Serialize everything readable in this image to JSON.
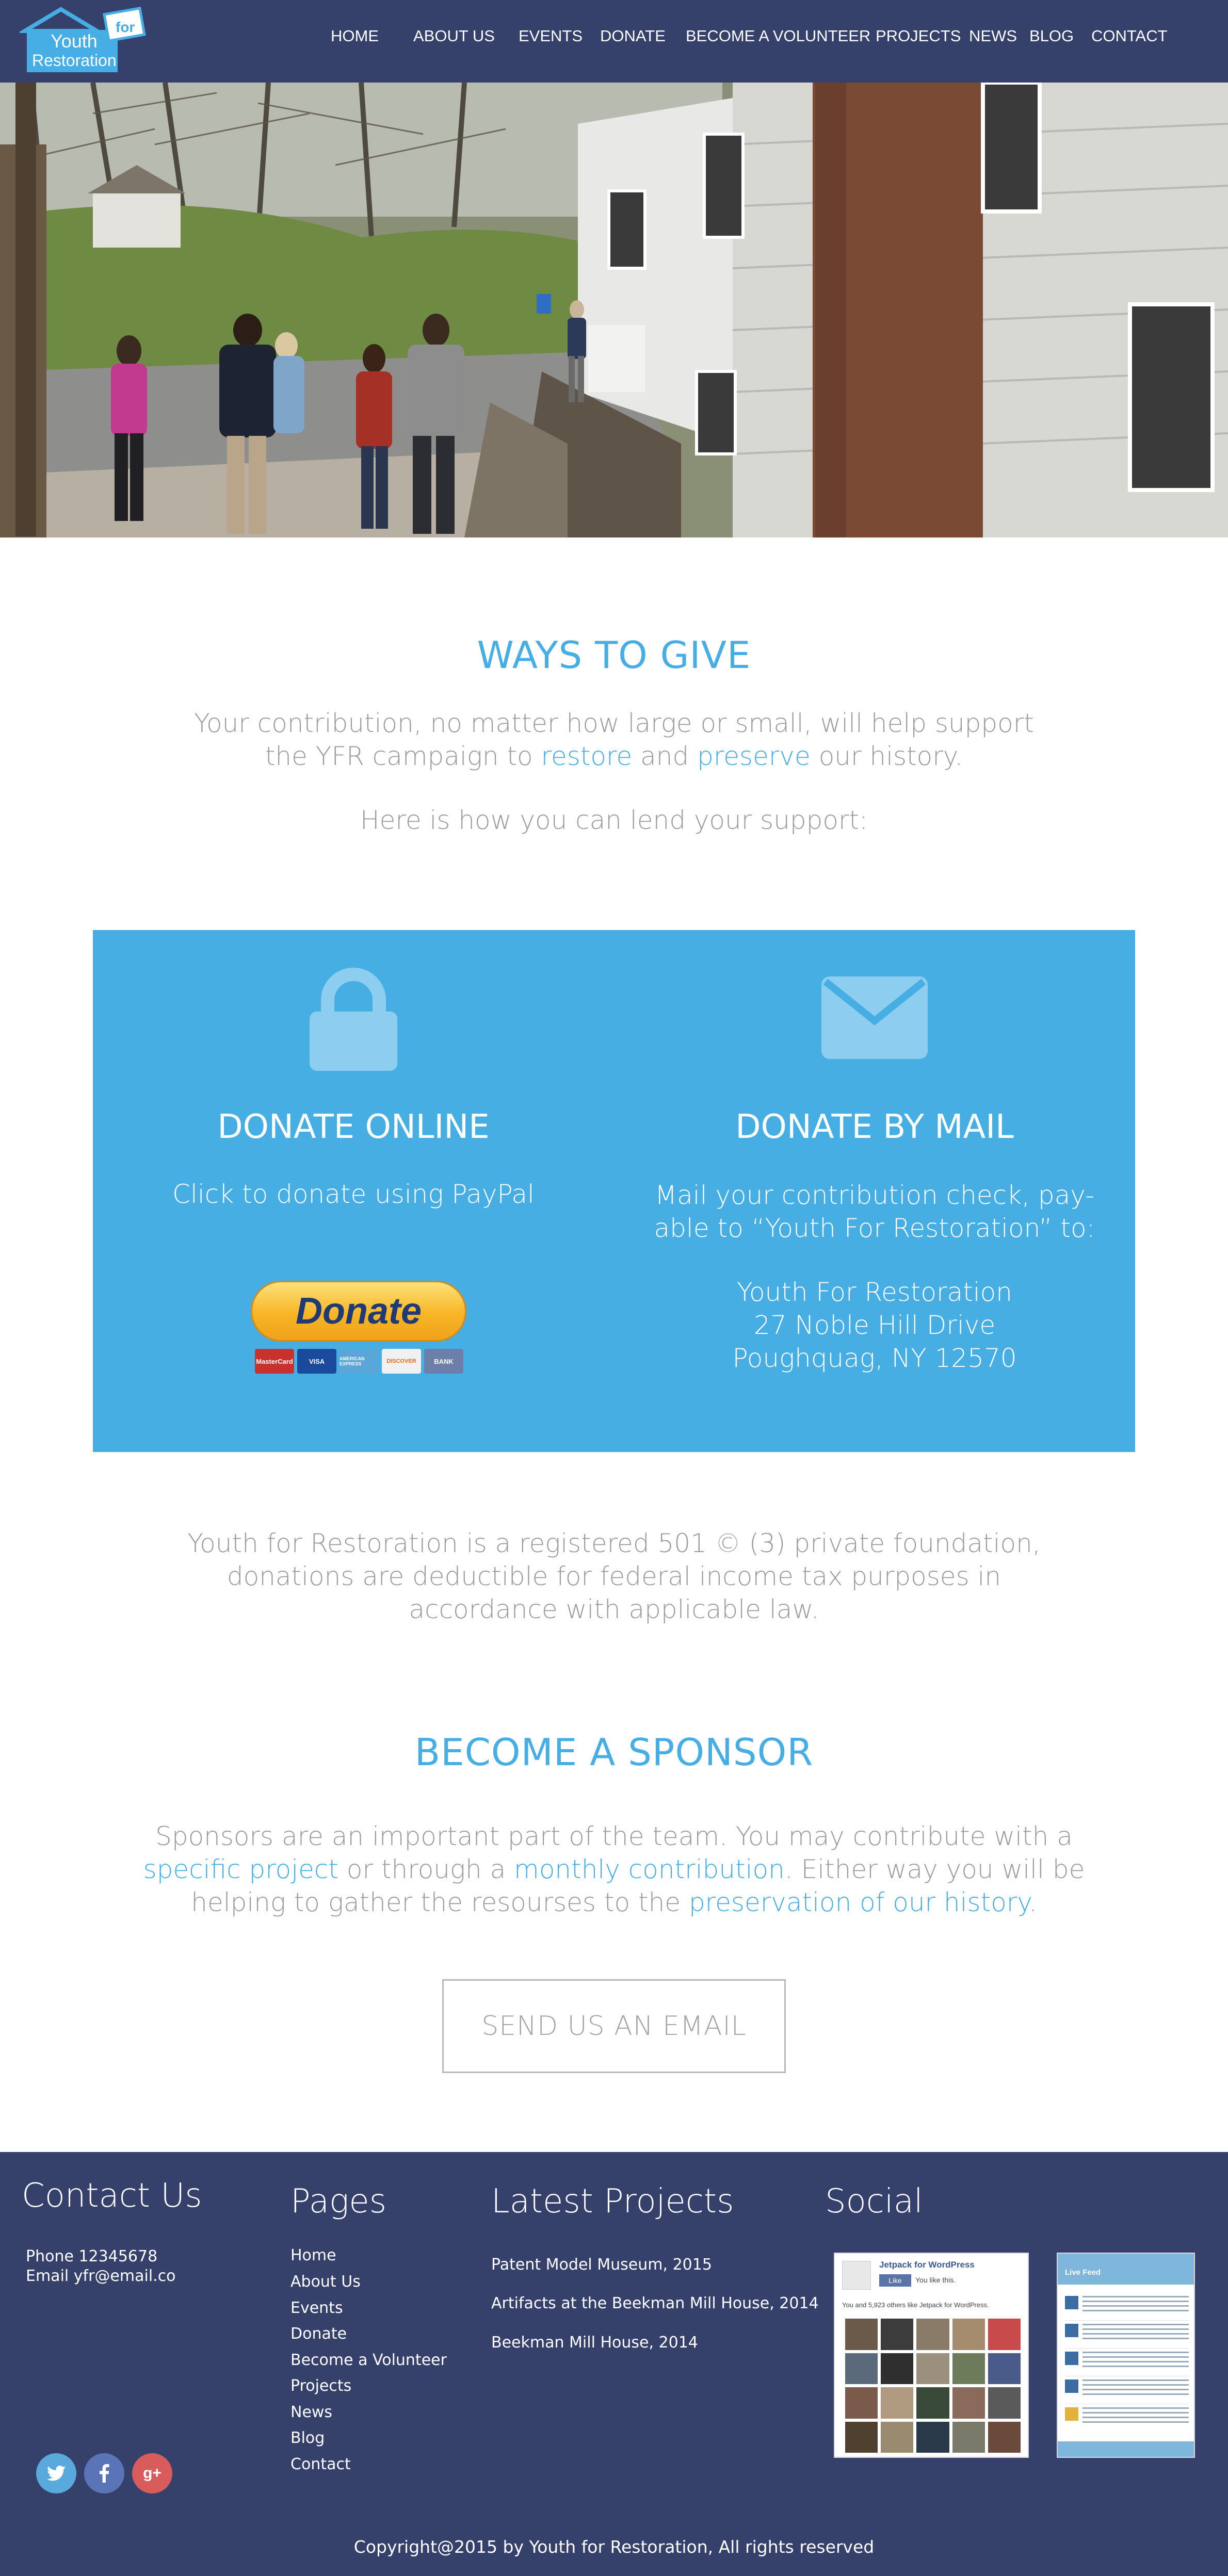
{
  "brand": {
    "logo_line1": "Youth",
    "logo_line2": "Restoration",
    "logo_badge": "for"
  },
  "nav": {
    "items": [
      {
        "label": "HOME"
      },
      {
        "label": "ABOUT US"
      },
      {
        "label": "EVENTS"
      },
      {
        "label": "DONATE"
      },
      {
        "label": "BECOME A VOLUNTEER"
      },
      {
        "label": "PROJECTS"
      },
      {
        "label": "NEWS"
      },
      {
        "label": "BLOG"
      },
      {
        "label": "CONTACT"
      }
    ]
  },
  "ways": {
    "title": "WAYS TO GIVE",
    "intro_part1": "Your contribution, no matter how large or small, will help support",
    "intro_part2": "the YFR campaign to",
    "intro_restore": "restore",
    "intro_and": "and",
    "intro_preserve": "preserve",
    "intro_part3": "our history.",
    "support_line": "Here is how you can lend your support:"
  },
  "online": {
    "title": "DONATE ONLINE",
    "text": "Click to donate using PayPal",
    "button_label": "Donate",
    "cards": [
      "MasterCard",
      "VISA",
      "AMERICAN EXPRESS",
      "DISCOVER",
      "BANK"
    ]
  },
  "mail": {
    "title": "DONATE BY MAIL",
    "text_line1": "Mail your contribution check, pay-",
    "text_line2": "able to “Youth For Restoration” to:",
    "address_line1": "Youth For Restoration",
    "address_line2": "27 Noble Hill Drive",
    "address_line3": "Poughquag, NY 12570"
  },
  "legal": {
    "line1": "Youth for Restoration is a registered 501 © (3) private foundation,",
    "line2": "donations are deductible for federal income tax purposes in",
    "line3": "accordance with applicable law."
  },
  "sponsor": {
    "title": "BECOME A SPONSOR",
    "line1": "Sponsors are an important part of the team. You may contribute with a",
    "link_specific": "specific project",
    "text_through": "or through a",
    "link_monthly": "monthly contribution",
    "text_either": ". Either way you will be",
    "line3_text": "helping to gather the resourses to the",
    "link_preservation": "preservation of our history",
    "line3_end": ".",
    "button_label": "SEND US AN EMAIL"
  },
  "footer": {
    "contact_title": "Contact Us",
    "phone": "Phone 12345678",
    "email": "Email yfr@email.co",
    "pages_title": "Pages",
    "pages": [
      "Home",
      "About Us",
      "Events",
      "Donate",
      "Become a Volunteer",
      "Projects",
      "News",
      "Blog",
      "Contact"
    ],
    "projects_title": "Latest Projects",
    "projects": [
      "Patent Model Museum, 2015",
      "Artifacts at the Beekman Mill House, 2014",
      "Beekman Mill House, 2014"
    ],
    "social_title": "Social",
    "widget1_title": "Jetpack for WordPress",
    "widget1_like": "Like",
    "widget1_like_text": "You like this.",
    "widget1_count": "You and 5,923 others like Jetpack for WordPress.",
    "widget2_title": "Live Feed",
    "copyright": "Copyright@2015 by Youth for Restoration, All rights reserved"
  },
  "colors": {
    "navy": "#35406b",
    "accent_blue": "#46aee4",
    "text_grey": "#9c9c9c",
    "twitter": "#5aa9dc",
    "facebook": "#5a74b8",
    "googleplus": "#d95c5c"
  }
}
